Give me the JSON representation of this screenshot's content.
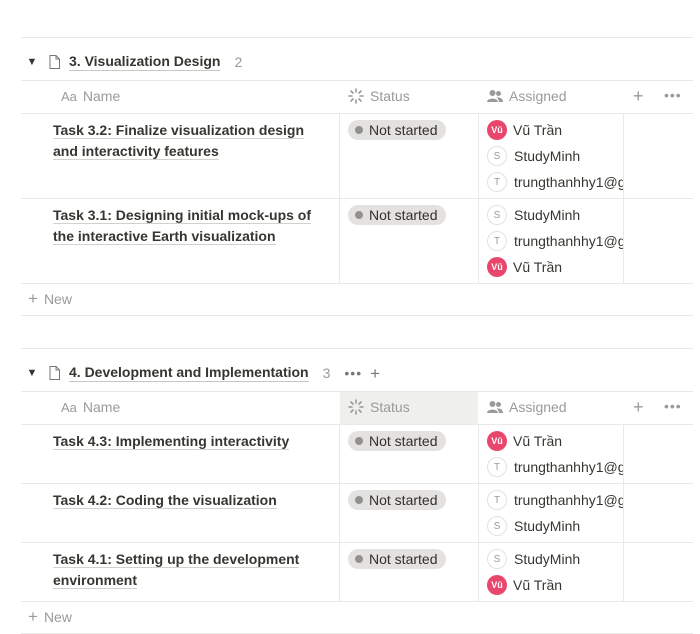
{
  "groups": [
    {
      "title": "3. Visualization Design",
      "count": "2",
      "columns": {
        "name": "Name",
        "name_prefix": "Aa",
        "status": "Status",
        "assigned": "Assigned"
      },
      "rows": [
        {
          "task": "Task 3.2: Finalize visualization design and interactivity features",
          "status": "Not started",
          "assigned": [
            {
              "avatar": "Vũ",
              "name": "Vũ Trần"
            },
            {
              "avatar": "S",
              "name": "StudyMinh"
            },
            {
              "avatar": "T",
              "name": "trungthanhhy1@g"
            }
          ]
        },
        {
          "task": "Task 3.1: Designing initial mock-ups of the interactive Earth visualization",
          "status": "Not started",
          "assigned": [
            {
              "avatar": "S",
              "name": "StudyMinh"
            },
            {
              "avatar": "T",
              "name": "trungthanhhy1@g"
            },
            {
              "avatar": "Vũ",
              "name": "Vũ Trần"
            }
          ]
        }
      ],
      "new_label": "New"
    },
    {
      "title": "4. Development and Implementation",
      "count": "3",
      "columns": {
        "name": "Name",
        "name_prefix": "Aa",
        "status": "Status",
        "assigned": "Assigned"
      },
      "rows": [
        {
          "task": "Task 4.3: Implementing interactivity",
          "status": "Not started",
          "assigned": [
            {
              "avatar": "Vũ",
              "name": "Vũ Trần"
            },
            {
              "avatar": "T",
              "name": "trungthanhhy1@g"
            }
          ]
        },
        {
          "task": "Task 4.2: Coding the visualization",
          "status": "Not started",
          "assigned": [
            {
              "avatar": "T",
              "name": "trungthanhhy1@g"
            },
            {
              "avatar": "S",
              "name": "StudyMinh"
            }
          ]
        },
        {
          "task": "Task 4.1: Setting up the development environment",
          "status": "Not started",
          "assigned": [
            {
              "avatar": "S",
              "name": "StudyMinh"
            },
            {
              "avatar": "Vũ",
              "name": "Vũ Trần"
            }
          ]
        }
      ],
      "new_label": "New"
    }
  ],
  "icons": {
    "toggle": "triangle-down-icon",
    "page": "page-icon",
    "status_column": "loading-spinner-icon",
    "assigned_column": "people-icon",
    "add": "plus-icon",
    "more": "more-dots-icon"
  },
  "colors": {
    "status_pill_bg": "#e3e2e0",
    "status_dot": "#91918e",
    "avatar_red": "#e8466d",
    "grid_line": "#e9e9e7",
    "muted_text": "#9b9a97"
  }
}
